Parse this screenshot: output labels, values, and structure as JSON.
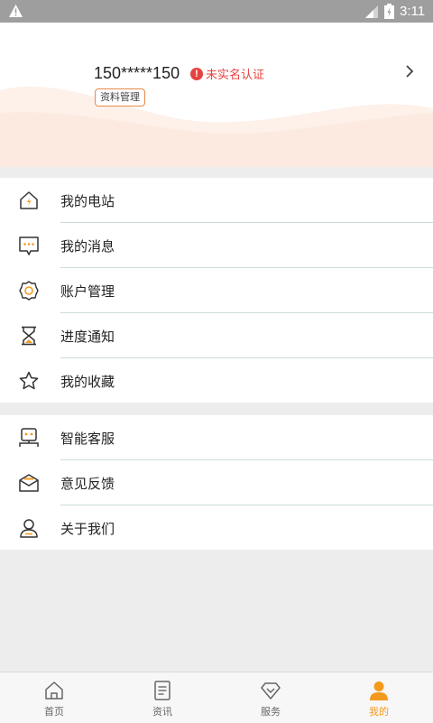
{
  "status_bar": {
    "time": "3:11"
  },
  "profile": {
    "phone": "150*****150",
    "verify_badge": "!",
    "verify_status": "未实名认证",
    "manage_tag": "资料管理"
  },
  "menu_group_1": [
    {
      "label": "我的电站",
      "icon": "station-house-icon"
    },
    {
      "label": "我的消息",
      "icon": "message-icon"
    },
    {
      "label": "账户管理",
      "icon": "account-gear-icon"
    },
    {
      "label": "进度通知",
      "icon": "hourglass-icon"
    },
    {
      "label": "我的收藏",
      "icon": "star-icon"
    }
  ],
  "menu_group_2": [
    {
      "label": "智能客服",
      "icon": "robot-icon"
    },
    {
      "label": "意见反馈",
      "icon": "feedback-mail-icon"
    },
    {
      "label": "关于我们",
      "icon": "person-icon"
    }
  ],
  "tabs": [
    {
      "label": "首页",
      "icon": "home-icon",
      "active": false
    },
    {
      "label": "资讯",
      "icon": "document-icon",
      "active": false
    },
    {
      "label": "服务",
      "icon": "service-icon",
      "active": false
    },
    {
      "label": "我的",
      "icon": "user-icon",
      "active": true
    }
  ],
  "colors": {
    "accent": "#f39a1e",
    "warning": "#e64340",
    "divider": "#c8dcd8",
    "status_bar": "#9e9e9e"
  }
}
